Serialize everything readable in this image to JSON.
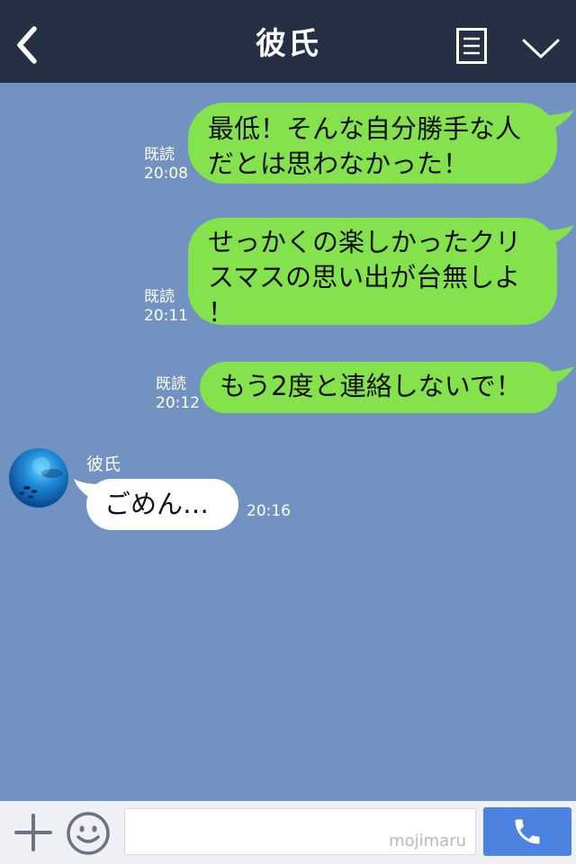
{
  "header": {
    "title": "彼氏",
    "back_icon": "chevron-left-icon",
    "menu_icon": "menu-list-icon",
    "collapse_icon": "chevron-down-icon",
    "background": "#253044"
  },
  "chat": {
    "background": "#7293c2",
    "outgoing_color": "#84e24c",
    "incoming_color": "#ffffff",
    "messages": [
      {
        "direction": "out",
        "lines": [
          "最低！そんな自分勝手な人",
          "だとは思わなかった！"
        ],
        "read_label": "既読",
        "time": "20:08"
      },
      {
        "direction": "out",
        "lines": [
          "せっかくの楽しかったクリ",
          "スマスの思い出が台無しよ",
          "！"
        ],
        "read_label": "既読",
        "time": "20:11"
      },
      {
        "direction": "out",
        "lines": [
          "もう2度と連絡しないで！"
        ],
        "read_label": "既読",
        "time": "20:12"
      },
      {
        "direction": "in",
        "sender": "彼氏",
        "lines": [
          "ごめん…"
        ],
        "time": "20:16"
      }
    ]
  },
  "footer": {
    "plus_icon": "plus-icon",
    "emoji_icon": "emoji-icon",
    "input_value": "",
    "watermark": "mojimaru",
    "call_icon": "phone-icon",
    "call_color": "#4c83e0"
  }
}
